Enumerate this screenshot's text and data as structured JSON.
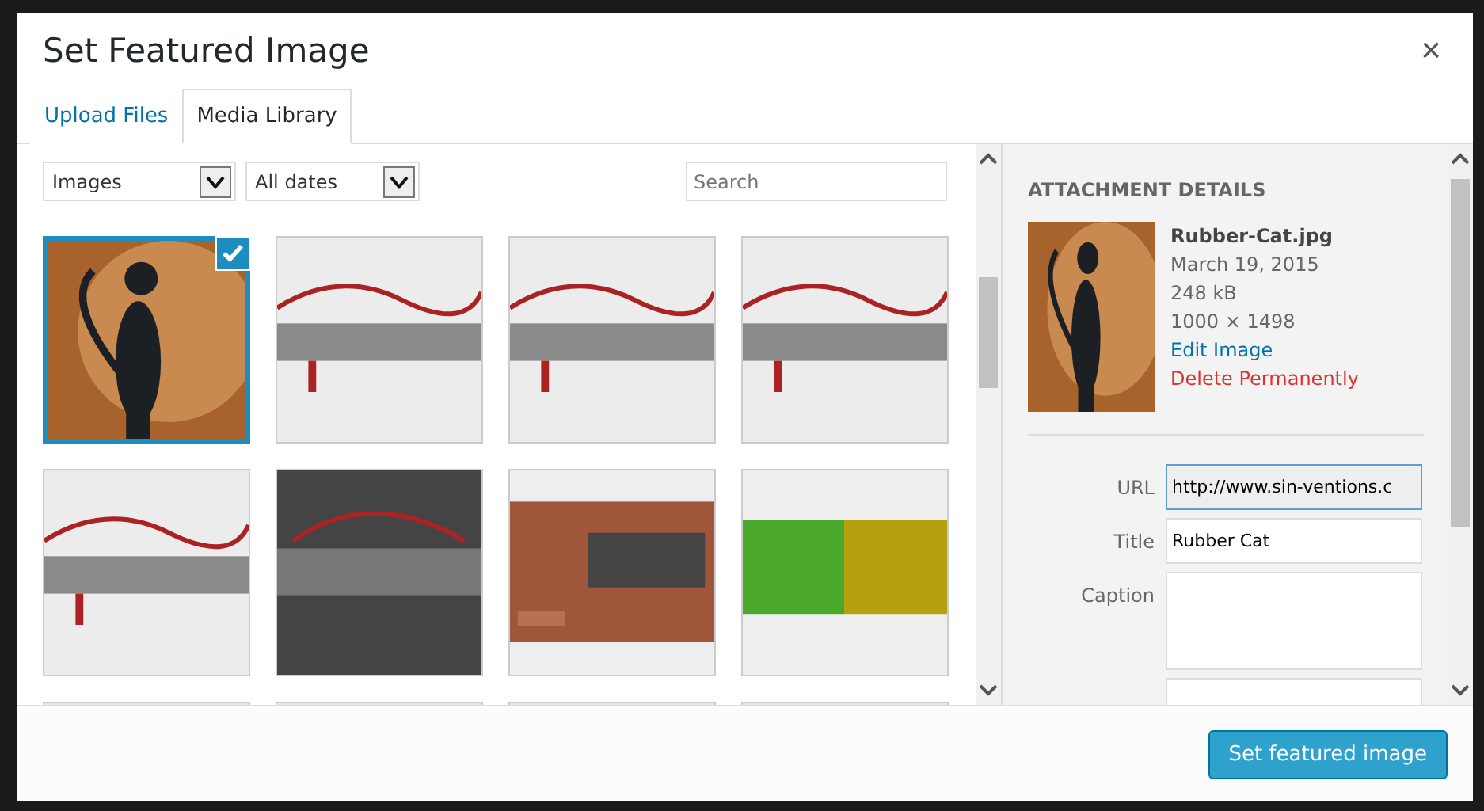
{
  "modal": {
    "title": "Set Featured Image",
    "close": "×"
  },
  "tabs": [
    {
      "label": "Upload Files",
      "selected": false
    },
    {
      "label": "Media Library",
      "selected": true
    }
  ],
  "filters": [
    {
      "value": "Images"
    },
    {
      "value": "All dates"
    }
  ],
  "search": {
    "placeholder": "Search"
  },
  "media": [
    {
      "kind": "picture",
      "selected": true
    },
    {
      "kind": "picture",
      "selected": false
    },
    {
      "kind": "picture",
      "selected": false
    },
    {
      "kind": "picture",
      "selected": false
    },
    {
      "kind": "picture",
      "selected": false
    },
    {
      "kind": "picture",
      "selected": false
    },
    {
      "kind": "picture",
      "selected": false
    },
    {
      "kind": "picture",
      "selected": false
    },
    {
      "kind": "picture",
      "selected": false
    },
    {
      "kind": "picture",
      "selected": false
    },
    {
      "kind": "picture",
      "selected": false
    },
    {
      "kind": "picture",
      "selected": false
    }
  ],
  "details": {
    "heading": "ATTACHMENT DETAILS",
    "filename": "Rubber-Cat.jpg",
    "date": "March 19, 2015",
    "size": "248 kB",
    "dimensions": "1000 × 1498",
    "edit_link": "Edit Image",
    "delete_link": "Delete Permanently",
    "fields": [
      {
        "label": "URL",
        "value": "http://www.sin-ventions.c",
        "kind": "input",
        "focused": true
      },
      {
        "label": "Title",
        "value": "Rubber Cat",
        "kind": "input",
        "focused": false
      },
      {
        "label": "Caption",
        "kind": "textarea"
      },
      {
        "kind": "input",
        "focused": false
      }
    ]
  },
  "footer": {
    "button": "Set featured image"
  }
}
